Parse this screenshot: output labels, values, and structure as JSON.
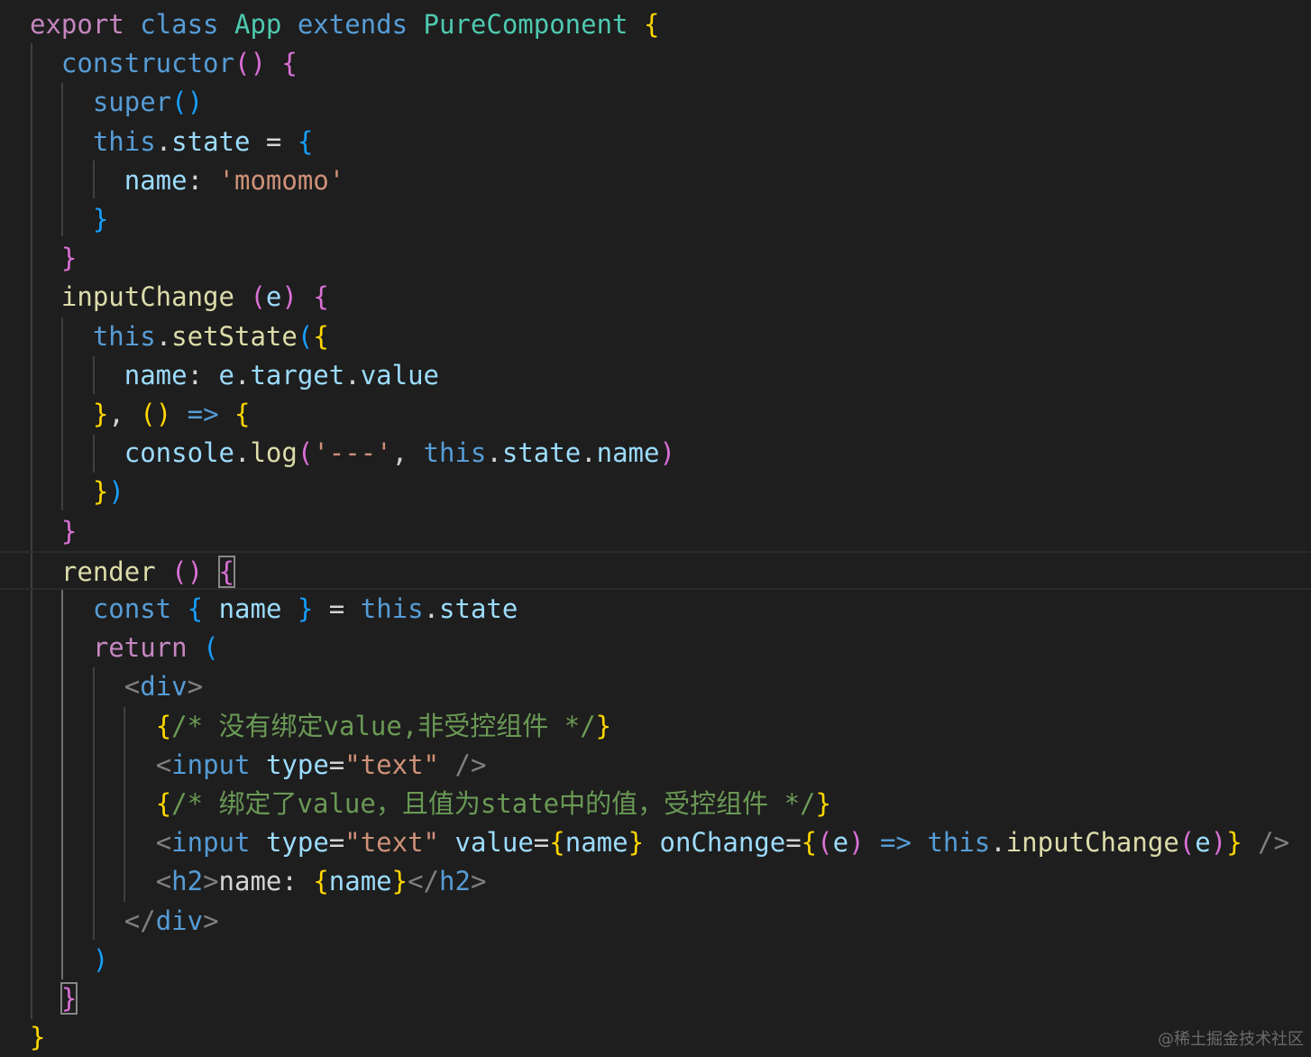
{
  "colors": {
    "background": "#1e1e1e",
    "keyword_purple": "#c586c0",
    "keyword_blue": "#569cd6",
    "class_name": "#4ec9b0",
    "function": "#dcdcaa",
    "variable": "#9cdcfe",
    "string": "#ce9178",
    "comment": "#6a9955",
    "plain": "#d4d4d4",
    "bracket_gold": "#ffd700",
    "bracket_pink": "#da70d6",
    "bracket_blue": "#179fff",
    "tag_punct": "#808080"
  },
  "code_lines": [
    [
      [
        "export ",
        "keyword_purple"
      ],
      [
        "class ",
        "keyword_blue"
      ],
      [
        "App ",
        "class_name"
      ],
      [
        "extends ",
        "keyword_blue"
      ],
      [
        "PureComponent ",
        "class_name"
      ],
      [
        "{",
        "bracket_gold"
      ]
    ],
    [
      [
        "  ",
        ""
      ],
      [
        "constructor",
        "keyword_blue"
      ],
      [
        "()",
        "bracket_pink"
      ],
      [
        " ",
        ""
      ],
      [
        "{",
        "bracket_pink"
      ]
    ],
    [
      [
        "    ",
        ""
      ],
      [
        "super",
        "keyword_blue"
      ],
      [
        "()",
        "bracket_blue"
      ]
    ],
    [
      [
        "    ",
        ""
      ],
      [
        "this",
        "keyword_blue"
      ],
      [
        ".",
        "plain"
      ],
      [
        "state",
        "variable"
      ],
      [
        " = ",
        "plain"
      ],
      [
        "{",
        "bracket_blue"
      ]
    ],
    [
      [
        "      ",
        ""
      ],
      [
        "name",
        "variable"
      ],
      [
        ": ",
        "plain"
      ],
      [
        "'momomo'",
        "string"
      ]
    ],
    [
      [
        "    ",
        ""
      ],
      [
        "}",
        "bracket_blue"
      ]
    ],
    [
      [
        "  ",
        ""
      ],
      [
        "}",
        "bracket_pink"
      ]
    ],
    [
      [
        "  ",
        ""
      ],
      [
        "inputChange",
        "function"
      ],
      [
        " ",
        ""
      ],
      [
        "(",
        "bracket_pink"
      ],
      [
        "e",
        "variable"
      ],
      [
        ")",
        "bracket_pink"
      ],
      [
        " ",
        ""
      ],
      [
        "{",
        "bracket_pink"
      ]
    ],
    [
      [
        "    ",
        ""
      ],
      [
        "this",
        "keyword_blue"
      ],
      [
        ".",
        "plain"
      ],
      [
        "setState",
        "function"
      ],
      [
        "(",
        "bracket_blue"
      ],
      [
        "{",
        "bracket_gold"
      ]
    ],
    [
      [
        "      ",
        ""
      ],
      [
        "name",
        "variable"
      ],
      [
        ": ",
        "plain"
      ],
      [
        "e",
        "variable"
      ],
      [
        ".",
        "plain"
      ],
      [
        "target",
        "variable"
      ],
      [
        ".",
        "plain"
      ],
      [
        "value",
        "variable"
      ]
    ],
    [
      [
        "    ",
        ""
      ],
      [
        "}",
        "bracket_gold"
      ],
      [
        ", ",
        "plain"
      ],
      [
        "()",
        "bracket_gold"
      ],
      [
        " ",
        ""
      ],
      [
        "=>",
        "keyword_blue"
      ],
      [
        " ",
        ""
      ],
      [
        "{",
        "bracket_gold"
      ]
    ],
    [
      [
        "      ",
        ""
      ],
      [
        "console",
        "variable"
      ],
      [
        ".",
        "plain"
      ],
      [
        "log",
        "function"
      ],
      [
        "(",
        "bracket_pink"
      ],
      [
        "'---'",
        "string"
      ],
      [
        ", ",
        "plain"
      ],
      [
        "this",
        "keyword_blue"
      ],
      [
        ".",
        "plain"
      ],
      [
        "state",
        "variable"
      ],
      [
        ".",
        "plain"
      ],
      [
        "name",
        "variable"
      ],
      [
        ")",
        "bracket_pink"
      ]
    ],
    [
      [
        "    ",
        ""
      ],
      [
        "}",
        "bracket_gold"
      ],
      [
        ")",
        "bracket_blue"
      ]
    ],
    [
      [
        "  ",
        ""
      ],
      [
        "}",
        "bracket_pink"
      ]
    ],
    [
      [
        "  ",
        ""
      ],
      [
        "render",
        "function"
      ],
      [
        " ",
        ""
      ],
      [
        "()",
        "bracket_pink"
      ],
      [
        " ",
        ""
      ],
      [
        "{",
        "bracket_pink"
      ]
    ],
    [
      [
        "    ",
        ""
      ],
      [
        "const",
        "keyword_blue"
      ],
      [
        " ",
        ""
      ],
      [
        "{",
        "bracket_blue"
      ],
      [
        " ",
        ""
      ],
      [
        "name",
        "variable"
      ],
      [
        " ",
        ""
      ],
      [
        "}",
        "bracket_blue"
      ],
      [
        " = ",
        "plain"
      ],
      [
        "this",
        "keyword_blue"
      ],
      [
        ".",
        "plain"
      ],
      [
        "state",
        "variable"
      ]
    ],
    [
      [
        "    ",
        ""
      ],
      [
        "return",
        "keyword_purple"
      ],
      [
        " ",
        ""
      ],
      [
        "(",
        "bracket_blue"
      ]
    ],
    [
      [
        "      ",
        ""
      ],
      [
        "<",
        "tag_punct"
      ],
      [
        "div",
        "keyword_blue"
      ],
      [
        ">",
        "tag_punct"
      ]
    ],
    [
      [
        "        ",
        ""
      ],
      [
        "{",
        "bracket_gold"
      ],
      [
        "/* 没有绑定value,非受控组件 */",
        "comment"
      ],
      [
        "}",
        "bracket_gold"
      ]
    ],
    [
      [
        "        ",
        ""
      ],
      [
        "<",
        "tag_punct"
      ],
      [
        "input",
        "keyword_blue"
      ],
      [
        " ",
        ""
      ],
      [
        "type",
        "variable"
      ],
      [
        "=",
        "plain"
      ],
      [
        "\"text\"",
        "string"
      ],
      [
        " ",
        ""
      ],
      [
        "/>",
        "tag_punct"
      ]
    ],
    [
      [
        "        ",
        ""
      ],
      [
        "{",
        "bracket_gold"
      ],
      [
        "/* 绑定了value，且值为state中的值，受控组件 */",
        "comment"
      ],
      [
        "}",
        "bracket_gold"
      ]
    ],
    [
      [
        "        ",
        ""
      ],
      [
        "<",
        "tag_punct"
      ],
      [
        "input",
        "keyword_blue"
      ],
      [
        " ",
        ""
      ],
      [
        "type",
        "variable"
      ],
      [
        "=",
        "plain"
      ],
      [
        "\"text\"",
        "string"
      ],
      [
        " ",
        ""
      ],
      [
        "value",
        "variable"
      ],
      [
        "=",
        "plain"
      ],
      [
        "{",
        "bracket_gold"
      ],
      [
        "name",
        "variable"
      ],
      [
        "}",
        "bracket_gold"
      ],
      [
        " ",
        ""
      ],
      [
        "onChange",
        "variable"
      ],
      [
        "=",
        "plain"
      ],
      [
        "{",
        "bracket_gold"
      ],
      [
        "(",
        "bracket_pink"
      ],
      [
        "e",
        "variable"
      ],
      [
        ")",
        "bracket_pink"
      ],
      [
        " ",
        ""
      ],
      [
        "=>",
        "keyword_blue"
      ],
      [
        " ",
        ""
      ],
      [
        "this",
        "keyword_blue"
      ],
      [
        ".",
        "plain"
      ],
      [
        "inputChange",
        "function"
      ],
      [
        "(",
        "bracket_pink"
      ],
      [
        "e",
        "variable"
      ],
      [
        ")",
        "bracket_pink"
      ],
      [
        "}",
        "bracket_gold"
      ],
      [
        " ",
        ""
      ],
      [
        "/>",
        "tag_punct"
      ]
    ],
    [
      [
        "        ",
        ""
      ],
      [
        "<",
        "tag_punct"
      ],
      [
        "h2",
        "keyword_blue"
      ],
      [
        ">",
        "tag_punct"
      ],
      [
        "name: ",
        "plain"
      ],
      [
        "{",
        "bracket_gold"
      ],
      [
        "name",
        "variable"
      ],
      [
        "}",
        "bracket_gold"
      ],
      [
        "</",
        "tag_punct"
      ],
      [
        "h2",
        "keyword_blue"
      ],
      [
        ">",
        "tag_punct"
      ]
    ],
    [
      [
        "      ",
        ""
      ],
      [
        "</",
        "tag_punct"
      ],
      [
        "div",
        "keyword_blue"
      ],
      [
        ">",
        "tag_punct"
      ]
    ],
    [
      [
        "    ",
        ""
      ],
      [
        ")",
        "bracket_blue"
      ]
    ],
    [
      [
        "  ",
        ""
      ],
      [
        "}",
        "bracket_pink"
      ]
    ],
    [
      [
        "}",
        "bracket_gold"
      ]
    ]
  ],
  "watermark": "@稀土掘金技术社区"
}
